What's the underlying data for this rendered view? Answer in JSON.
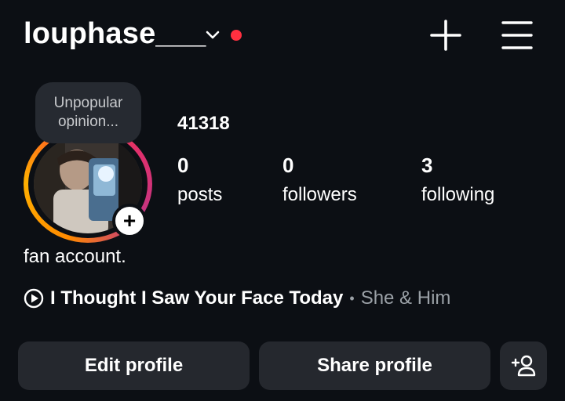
{
  "header": {
    "username": "louphase___",
    "chevron_icon": "chevron-down-icon",
    "notification_color": "#ff3040",
    "create_icon": "plus-icon",
    "menu_icon": "hamburger-menu-icon"
  },
  "profile": {
    "note": [
      "Unpopular",
      "opinion..."
    ],
    "add_story_icon": "+",
    "display_name": "41318",
    "stats": [
      {
        "value": "0",
        "label": "posts"
      },
      {
        "value": "0",
        "label": "followers"
      },
      {
        "value": "3",
        "label": "following"
      }
    ],
    "bio": "fan account.",
    "music": {
      "song": "I Thought I Saw Your Face Today",
      "separator": "•",
      "artist": "She & Him"
    }
  },
  "actions": {
    "edit_label": "Edit profile",
    "share_label": "Share profile",
    "add_person_icon": "add-person-icon"
  }
}
